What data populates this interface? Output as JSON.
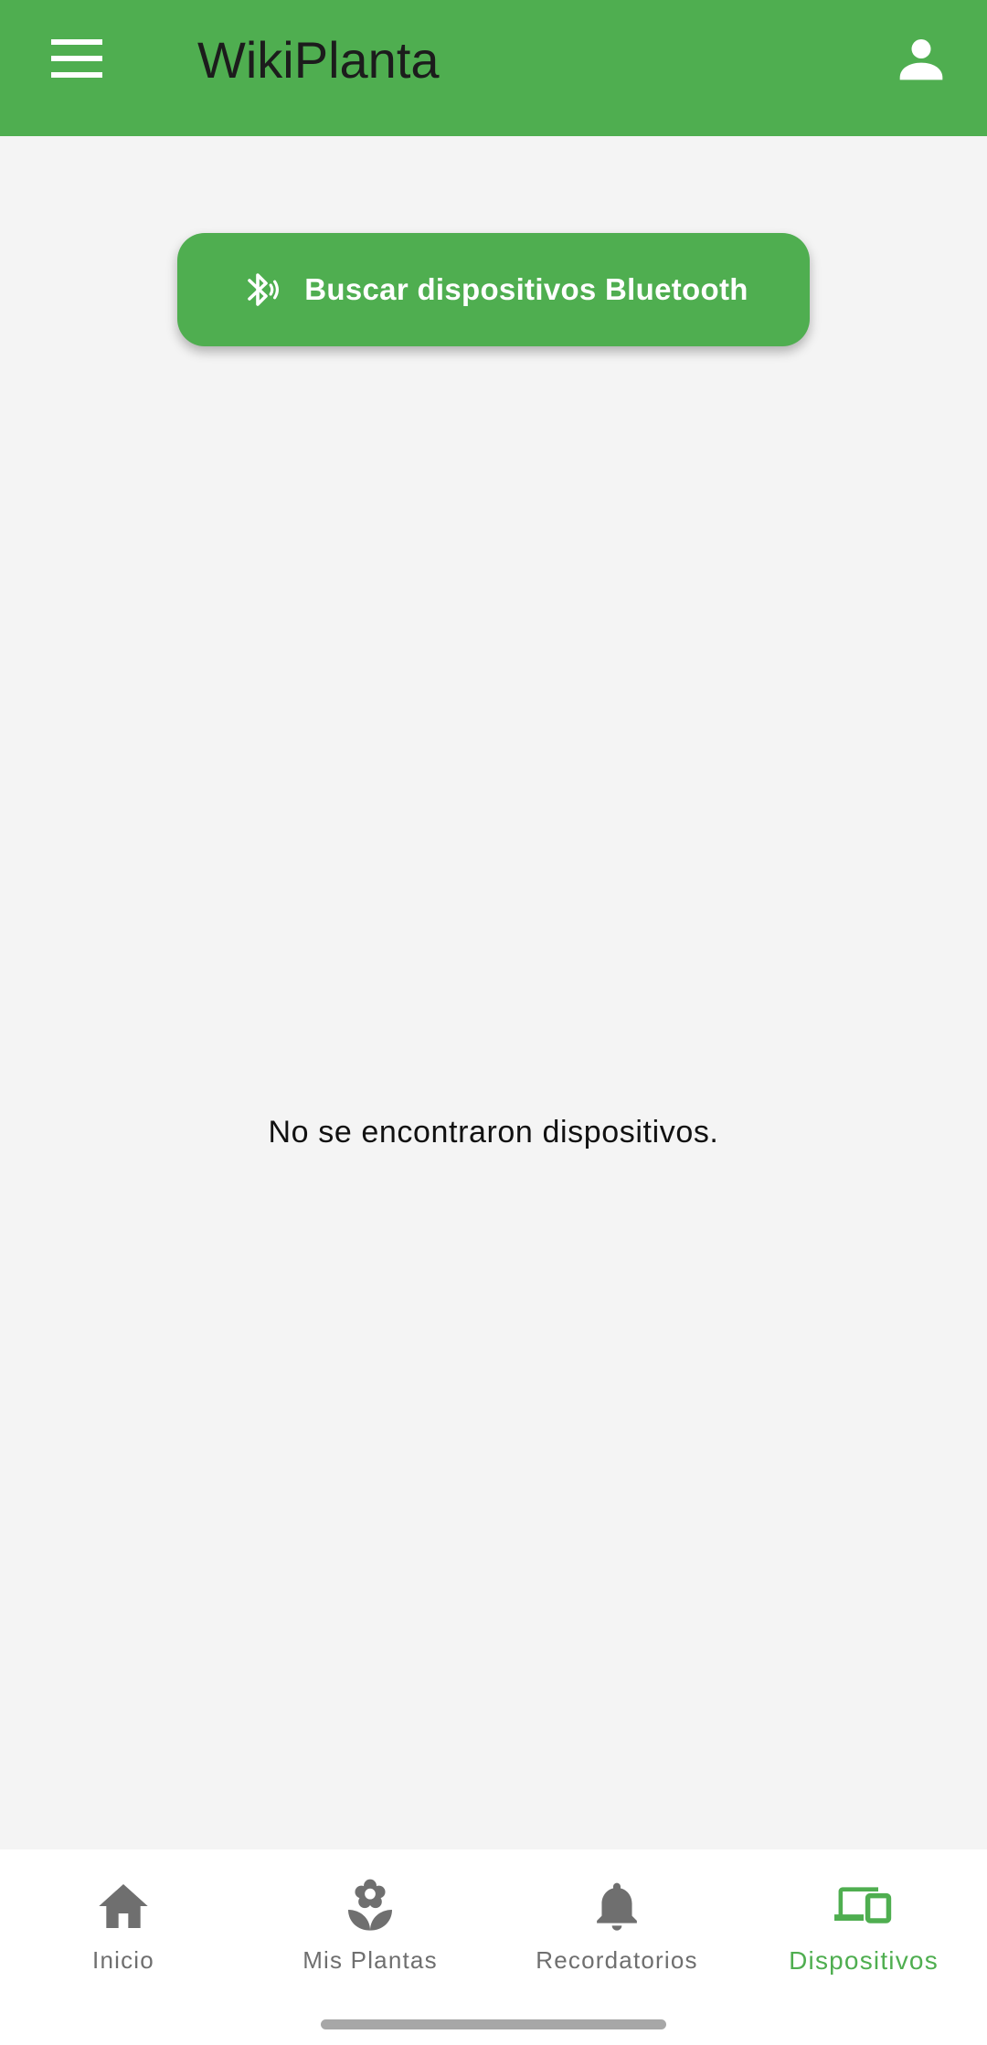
{
  "app_bar": {
    "title": "WikiPlanta",
    "menu_icon": "menu-icon",
    "profile_icon": "person-icon",
    "color": "#4fae50"
  },
  "main": {
    "scan_button": {
      "label": "Buscar dispositivos Bluetooth",
      "icon": "bluetooth-searching-icon"
    },
    "empty_message": "No se encontraron dispositivos."
  },
  "bottom_nav": {
    "active_color": "#4fae50",
    "inactive_color": "#6f6f6f",
    "items": [
      {
        "label": "Inicio",
        "icon": "home-icon",
        "active": false
      },
      {
        "label": "Mis Plantas",
        "icon": "flower-icon",
        "active": false
      },
      {
        "label": "Recordatorios",
        "icon": "bell-icon",
        "active": false
      },
      {
        "label": "Dispositivos",
        "icon": "devices-icon",
        "active": true
      }
    ]
  }
}
